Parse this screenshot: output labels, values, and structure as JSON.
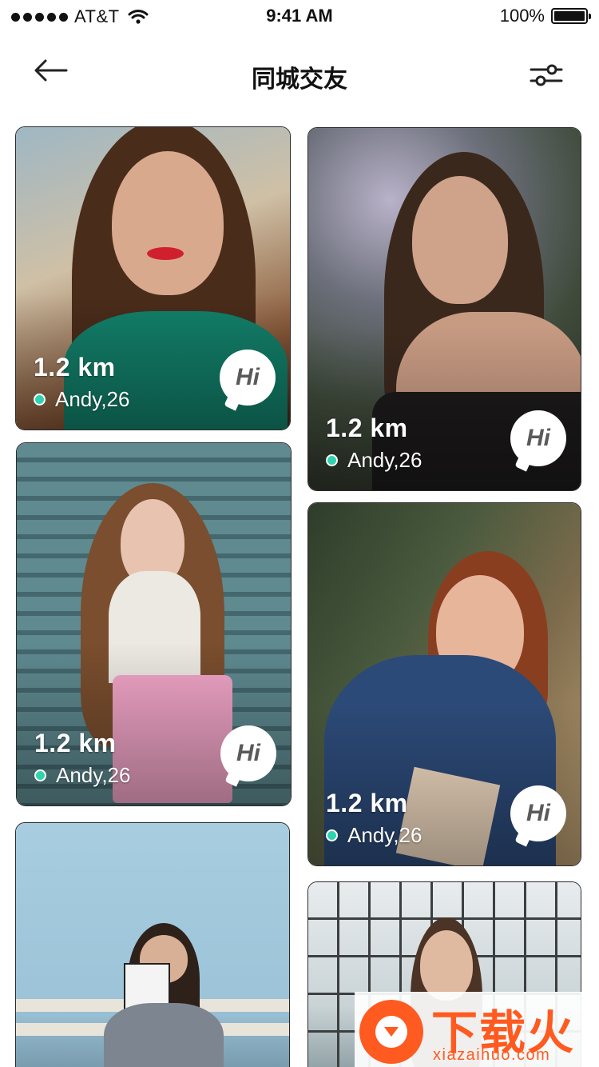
{
  "status_bar": {
    "carrier": "AT&T",
    "time": "9:41 AM",
    "battery": "100%",
    "battery_level": 1.0
  },
  "nav": {
    "title": "同城交友",
    "back_icon": "arrow-left-icon",
    "filter_icon": "sliders-icon"
  },
  "cards": [
    {
      "distance": "1.2 km",
      "name": "Andy,26",
      "hi": "Hi"
    },
    {
      "distance": "1.2 km",
      "name": "Andy,26",
      "hi": "Hi"
    },
    {
      "distance": "1.2 km",
      "name": "Andy,26",
      "hi": "Hi"
    },
    {
      "distance": "1.2 km",
      "name": "Andy,26",
      "hi": "Hi"
    },
    {
      "distance": "",
      "name": "",
      "hi": ""
    },
    {
      "distance": "",
      "name": "",
      "hi": ""
    }
  ],
  "watermark": {
    "brand": "下载火",
    "domain": "xiazaihuo.com"
  },
  "colors": {
    "online": "#2fd3b0",
    "watermark": "#ff5a1f"
  }
}
